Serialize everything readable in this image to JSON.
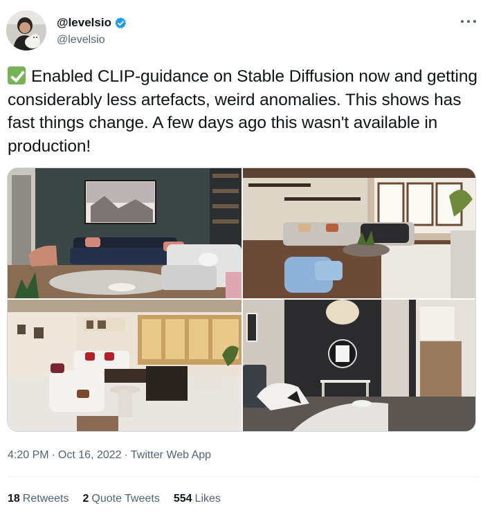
{
  "author": {
    "display_name": "@levelsio",
    "handle": "@levelsio",
    "verified": true,
    "avatar_icon": "profile-photo-with-dog"
  },
  "menu": {
    "icon": "more-horizontal-icon"
  },
  "tweet": {
    "emoji_icon": "green-check-mark-emoji",
    "text": "Enabled CLIP-guidance on Stable Diffusion now and getting considerably less artefacts, weird anomalies. This shows has fast things change. A few days ago this wasn't available in production!"
  },
  "media": {
    "count": 4,
    "images": [
      {
        "subject": "dark-grey-living-room"
      },
      {
        "subject": "sunken-lounge-with-blue-armchair"
      },
      {
        "subject": "white-living-room-with-red-pillows"
      },
      {
        "subject": "bedroom-with-round-mirror"
      }
    ]
  },
  "meta": {
    "time": "4:20 PM",
    "date": "Oct 16, 2022",
    "source": "Twitter Web App",
    "separator": "·"
  },
  "stats": {
    "retweets_count": "18",
    "retweets_label": "Retweets",
    "quote_count": "2",
    "quote_label": "Quote Tweets",
    "likes_count": "554",
    "likes_label": "Likes"
  },
  "colors": {
    "verified_blue": "#1d9bf0",
    "secondary_text": "#536471",
    "primary_text": "#0f1419",
    "check_green": "#77b255"
  }
}
